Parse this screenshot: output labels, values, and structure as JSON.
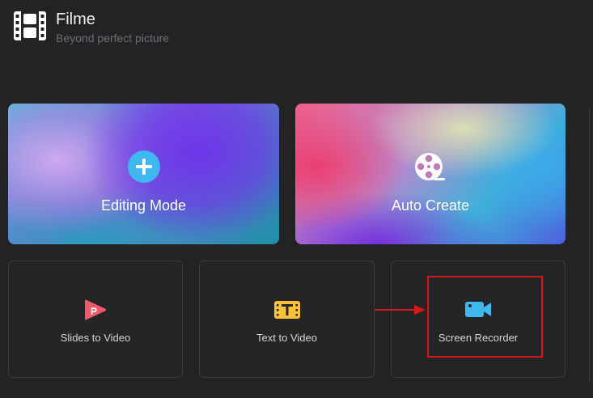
{
  "app": {
    "title": "Filme",
    "subtitle": "Beyond perfect picture",
    "logo_icon": "film-strip-icon"
  },
  "modes": [
    {
      "label": "Editing Mode",
      "icon": "plus-circle-icon",
      "icon_color": "#3fb8f0"
    },
    {
      "label": "Auto Create",
      "icon": "film-reel-icon",
      "icon_color": "#ffffff"
    }
  ],
  "tools": [
    {
      "label": "Slides to Video",
      "icon": "slides-play-icon",
      "icon_color": "#f05a6a"
    },
    {
      "label": "Text to Video",
      "icon": "text-card-icon",
      "icon_color": "#f5c23a"
    },
    {
      "label": "Screen Recorder",
      "icon": "video-camera-icon",
      "icon_color": "#3fb8f0"
    }
  ],
  "annotation": {
    "highlight_color": "#d81818",
    "target": "Screen Recorder"
  }
}
